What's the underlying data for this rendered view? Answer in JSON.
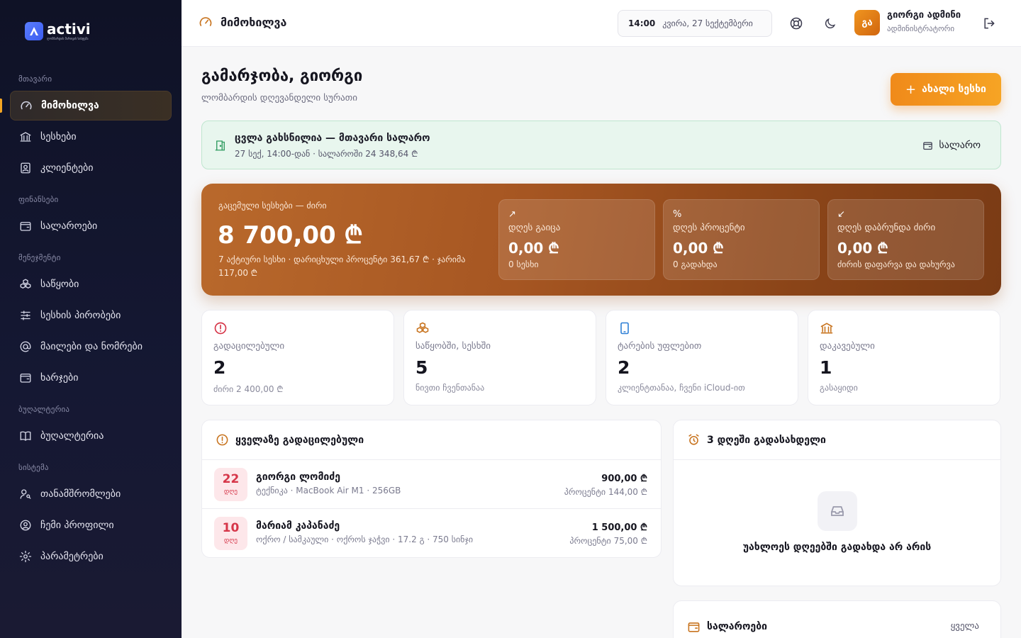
{
  "app": {
    "logo_name": "activi",
    "logo_sub": "ლომბარდის მართვის სისტემა"
  },
  "sidebar": {
    "sections": {
      "main": "მთავარი",
      "finance": "ფინანსები",
      "management": "მენეჯმენტი",
      "accounting": "ბუღალტერია",
      "system": "სისტემა"
    },
    "items": [
      {
        "label": "მიმოხილვა",
        "icon": "gauge-icon"
      },
      {
        "label": "სესხები",
        "icon": "bank-icon"
      },
      {
        "label": "კლიენტები",
        "icon": "user-card-icon"
      },
      {
        "label": "სალაროები",
        "icon": "wallet-icon"
      },
      {
        "label": "საწყობი",
        "icon": "boxes-icon"
      },
      {
        "label": "სესხის პირობები",
        "icon": "sliders-icon"
      },
      {
        "label": "მაილები და ნომრები",
        "icon": "at-icon"
      },
      {
        "label": "ხარჯები",
        "icon": "wallet-icon"
      },
      {
        "label": "ბუღალტერია",
        "icon": "book-icon"
      },
      {
        "label": "თანამშრომლები",
        "icon": "user-key-icon"
      },
      {
        "label": "ჩემი პროფილი",
        "icon": "user-circle-icon"
      },
      {
        "label": "პარამეტრები",
        "icon": "gear-icon"
      }
    ]
  },
  "header": {
    "title": "მიმოხილვა",
    "time": "14:00",
    "date": "კვირა, 27 სექტემბერი",
    "user_initials": "გა",
    "user_name": "გიორგი ადმინი",
    "user_role": "ადმინისტრატორი"
  },
  "greeting": {
    "title": "გამარჯობა, გიორგი",
    "subtitle": "ლომბარდის დღევანდელი სურათი",
    "new_loan": "ახალი სესხი"
  },
  "shift": {
    "title": "ცვლა გახსნილია — მთავარი სალარო",
    "subtitle": "27 სექ, 14:00-დან · სალაროში 24 348,64 ₾",
    "link": "სალარო"
  },
  "hero": {
    "label": "გაცემული სესხები — ძირი",
    "amount": "8 700,00 ₾",
    "sub": "7 აქტიური სესხი · დარიცხული პროცენტი 361,67 ₾ · ჯარიმა 117,00 ₾",
    "cards": [
      {
        "icon": "↗",
        "label": "დღეს გაიცა",
        "value": "0,00 ₾",
        "sub": "0 სესხი"
      },
      {
        "icon": "%",
        "label": "დღეს პროცენტი",
        "value": "0,00 ₾",
        "sub": "0 გადახდა"
      },
      {
        "icon": "↙",
        "label": "დღეს დაბრუნდა ძირი",
        "value": "0,00 ₾",
        "sub": "ძირის დაფარვა და დახურვა"
      }
    ]
  },
  "stats": [
    {
      "icon": "alert-circle-icon",
      "label": "გადაცილებული",
      "value": "2",
      "sub": "ძირი 2 400,00 ₾",
      "color": "#d63649"
    },
    {
      "icon": "boxes-icon",
      "label": "საწყობში, სესხში",
      "value": "5",
      "sub": "ნივთი ჩვენთანაა",
      "color": "#c8741f"
    },
    {
      "icon": "tablet-icon",
      "label": "ტარების უფლებით",
      "value": "2",
      "sub": "კლიენტთანაა, ჩვენი iCloud-ით",
      "color": "#2d7fd6"
    },
    {
      "icon": "bank-icon",
      "label": "დაკავებული",
      "value": "1",
      "sub": "გასაყიდი",
      "color": "#c8741f"
    }
  ],
  "overdue": {
    "title": "ყველაზე გადაცილებული",
    "rows": [
      {
        "days": "22",
        "unit": "დღე",
        "name": "გიორგი ლომიძე",
        "item": "ტექნიკა · MacBook Air M1 · 256GB",
        "amount": "900,00 ₾",
        "interest": "პროცენტი 144,00 ₾"
      },
      {
        "days": "10",
        "unit": "დღე",
        "name": "მარიამ კაპანაძე",
        "item": "ოქრო / სამკაული · ოქროს ჯაჭვი · 17.2 გ · 750 სინჯი",
        "amount": "1 500,00 ₾",
        "interest": "პროცენტი 75,00 ₾"
      }
    ]
  },
  "upcoming": {
    "title": "3 დღეში გადასახდელი",
    "empty": "უახლოეს დღეებში გადახდა არ არის"
  },
  "cashboxes": {
    "title": "სალაროები",
    "see_all": "ყველა"
  },
  "colors": {
    "accent": "#f08a1a",
    "sidebar_bg": "#0f1226",
    "danger": "#d63649",
    "success": "#2c9a5e"
  }
}
